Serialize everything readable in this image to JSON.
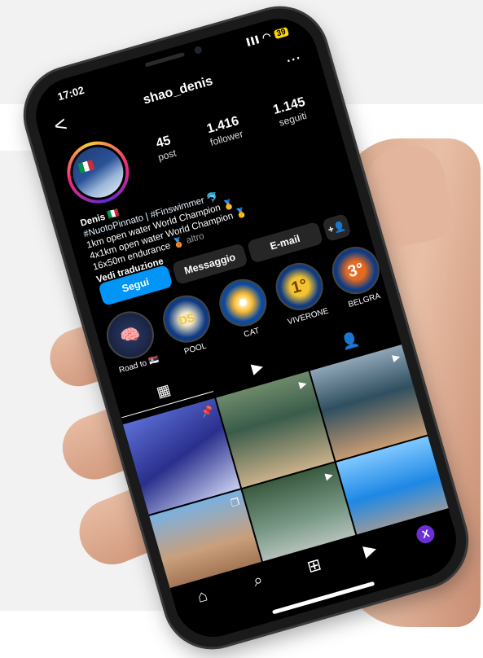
{
  "status": {
    "time": "17:02",
    "battery": "39"
  },
  "header": {
    "back": "<",
    "username": "shao_denis",
    "more": "..."
  },
  "stats": [
    {
      "value": "45",
      "label": "post"
    },
    {
      "value": "1.416",
      "label": "follower"
    },
    {
      "value": "1.145",
      "label": "seguiti"
    }
  ],
  "bio": {
    "name": "Denis 🇮🇹",
    "tags": "#NuotoPinnato | #Finswimmer 🐬",
    "line1": "1km open water World Champion 🥇",
    "line2": "4x1km open water World Champion 🥇",
    "line3": "16x50m endurance 🥉",
    "more": "altro",
    "translate": "Vedi traduzione"
  },
  "buttons": {
    "follow": "Segui",
    "message": "Messaggio",
    "email": "E-mail",
    "add": "+👤"
  },
  "highlights": [
    {
      "label": "Road to 🇷🇸",
      "glyph": "🧠"
    },
    {
      "label": "POOL",
      "glyph": "DS"
    },
    {
      "label": "CAT",
      "glyph": "✺"
    },
    {
      "label": "VIVERONE",
      "glyph": "1°"
    },
    {
      "label": "BELGRA",
      "glyph": "3°"
    }
  ],
  "tabs": [
    "▦",
    "▶",
    "👤"
  ],
  "grid_marks": [
    "📌",
    "▶",
    "▶",
    "❐",
    "▶",
    ""
  ],
  "nav": {
    "home": "⌂",
    "search": "⌕",
    "create": "⊞",
    "reels": "▶",
    "profile": "X"
  }
}
